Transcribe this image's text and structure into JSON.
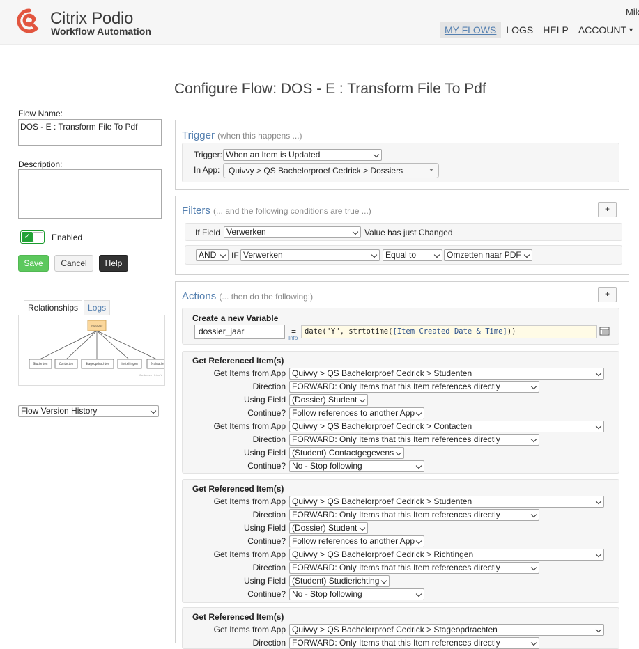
{
  "app": {
    "brand_title": "Citrix Podio",
    "brand_subtitle": "Workflow Automation",
    "user_name": "Mik"
  },
  "nav": {
    "items": [
      {
        "label": "MY FLOWS",
        "active": true
      },
      {
        "label": "LOGS"
      },
      {
        "label": "HELP"
      },
      {
        "label": "ACCOUNT"
      }
    ]
  },
  "page": {
    "title": "Configure Flow: DOS - E : Transform File To Pdf"
  },
  "left": {
    "flow_name_label": "Flow Name:",
    "flow_name_value": "DOS - E : Transform File To Pdf",
    "description_label": "Description:",
    "description_value": "",
    "enabled_label": "Enabled",
    "save_label": "Save",
    "cancel_label": "Cancel",
    "help_label": "Help",
    "tabs": [
      "Relationships",
      "Logs"
    ],
    "diagram": {
      "root": "Dossiers",
      "children": [
        "Studenten",
        "Contacten",
        "Stageopdrachten",
        "Instellingen",
        "Evaluaties"
      ],
      "footer": "Contacten  ·  Intra V"
    },
    "version_history": "Flow Version History"
  },
  "trigger": {
    "title": "Trigger",
    "hint": "(when this happens ...)",
    "trigger_label": "Trigger:",
    "trigger_value": "When an Item is Updated",
    "app_label": "In App:",
    "app_value": "Quivvy > QS Bachelorproef Cedrick > Dossiers"
  },
  "filters": {
    "title": "Filters",
    "hint": "(... and the following conditions are true ...)",
    "add_label": "+",
    "if_field_label": "If Field",
    "if_field_value": "Verwerken",
    "changed_text": "Value has just Changed",
    "and_value": "AND",
    "if_label": "IF",
    "field2_value": "Verwerken",
    "operator_value": "Equal to",
    "compare_value": "Omzetten naar PDF"
  },
  "actions": {
    "title": "Actions",
    "hint": "(... then do the following:)",
    "add_label": "+",
    "variable": {
      "title": "Create a new Variable",
      "name": "dossier_jaar",
      "equals": "=",
      "info": "Info",
      "expr_pre": "date(\"Y\", strtotime(",
      "expr_token": "[Item Created Date & Time]",
      "expr_post": "))"
    },
    "labels": {
      "block_title": "Get Referenced Item(s)",
      "get_items": "Get Items from App",
      "direction": "Direction",
      "using_field": "Using Field",
      "continue": "Continue?"
    },
    "blocks": [
      {
        "steps": [
          {
            "app": "Quivvy > QS Bachelorproef Cedrick > Studenten",
            "direction": "FORWARD: Only Items that this Item references directly",
            "field": "(Dossier) Student",
            "continue": "Follow references to another App"
          },
          {
            "app": "Quivvy > QS Bachelorproef Cedrick > Contacten",
            "direction": "FORWARD: Only Items that this Item references directly",
            "field": "(Student) Contactgegevens",
            "continue": "No - Stop following"
          }
        ]
      },
      {
        "steps": [
          {
            "app": "Quivvy > QS Bachelorproef Cedrick > Studenten",
            "direction": "FORWARD: Only Items that this Item references directly",
            "field": "(Dossier) Student",
            "continue": "Follow references to another App"
          },
          {
            "app": "Quivvy > QS Bachelorproef Cedrick > Richtingen",
            "direction": "FORWARD: Only Items that this Item references directly",
            "field": "(Student) Studierichting",
            "continue": "No - Stop following"
          }
        ]
      },
      {
        "steps": [
          {
            "app": "Quivvy > QS Bachelorproef Cedrick > Stageopdrachten",
            "direction": "FORWARD: Only Items that this Item references directly"
          }
        ]
      }
    ]
  }
}
